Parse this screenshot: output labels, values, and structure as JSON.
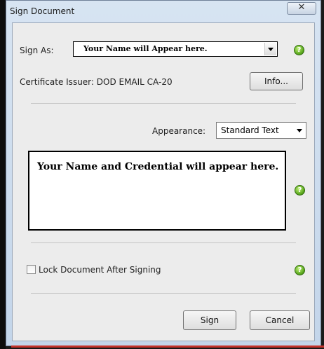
{
  "window": {
    "title": "Sign Document",
    "close_label": "✕"
  },
  "sign_as": {
    "label": "Sign As:",
    "value": "Your Name will Appear here."
  },
  "certificate": {
    "issuer_text": "Certificate Issuer: DOD EMAIL CA-20",
    "info_button": "Info..."
  },
  "appearance": {
    "label": "Appearance:",
    "value": "Standard Text"
  },
  "preview": {
    "text": "Your Name and Credential will appear here."
  },
  "lock": {
    "label": "Lock Document After Signing",
    "checked": false
  },
  "help_glyph": "?",
  "buttons": {
    "sign": "Sign",
    "cancel": "Cancel"
  },
  "colors": {
    "help_green": "#5aa81e",
    "accent_red": "#c4322b"
  }
}
